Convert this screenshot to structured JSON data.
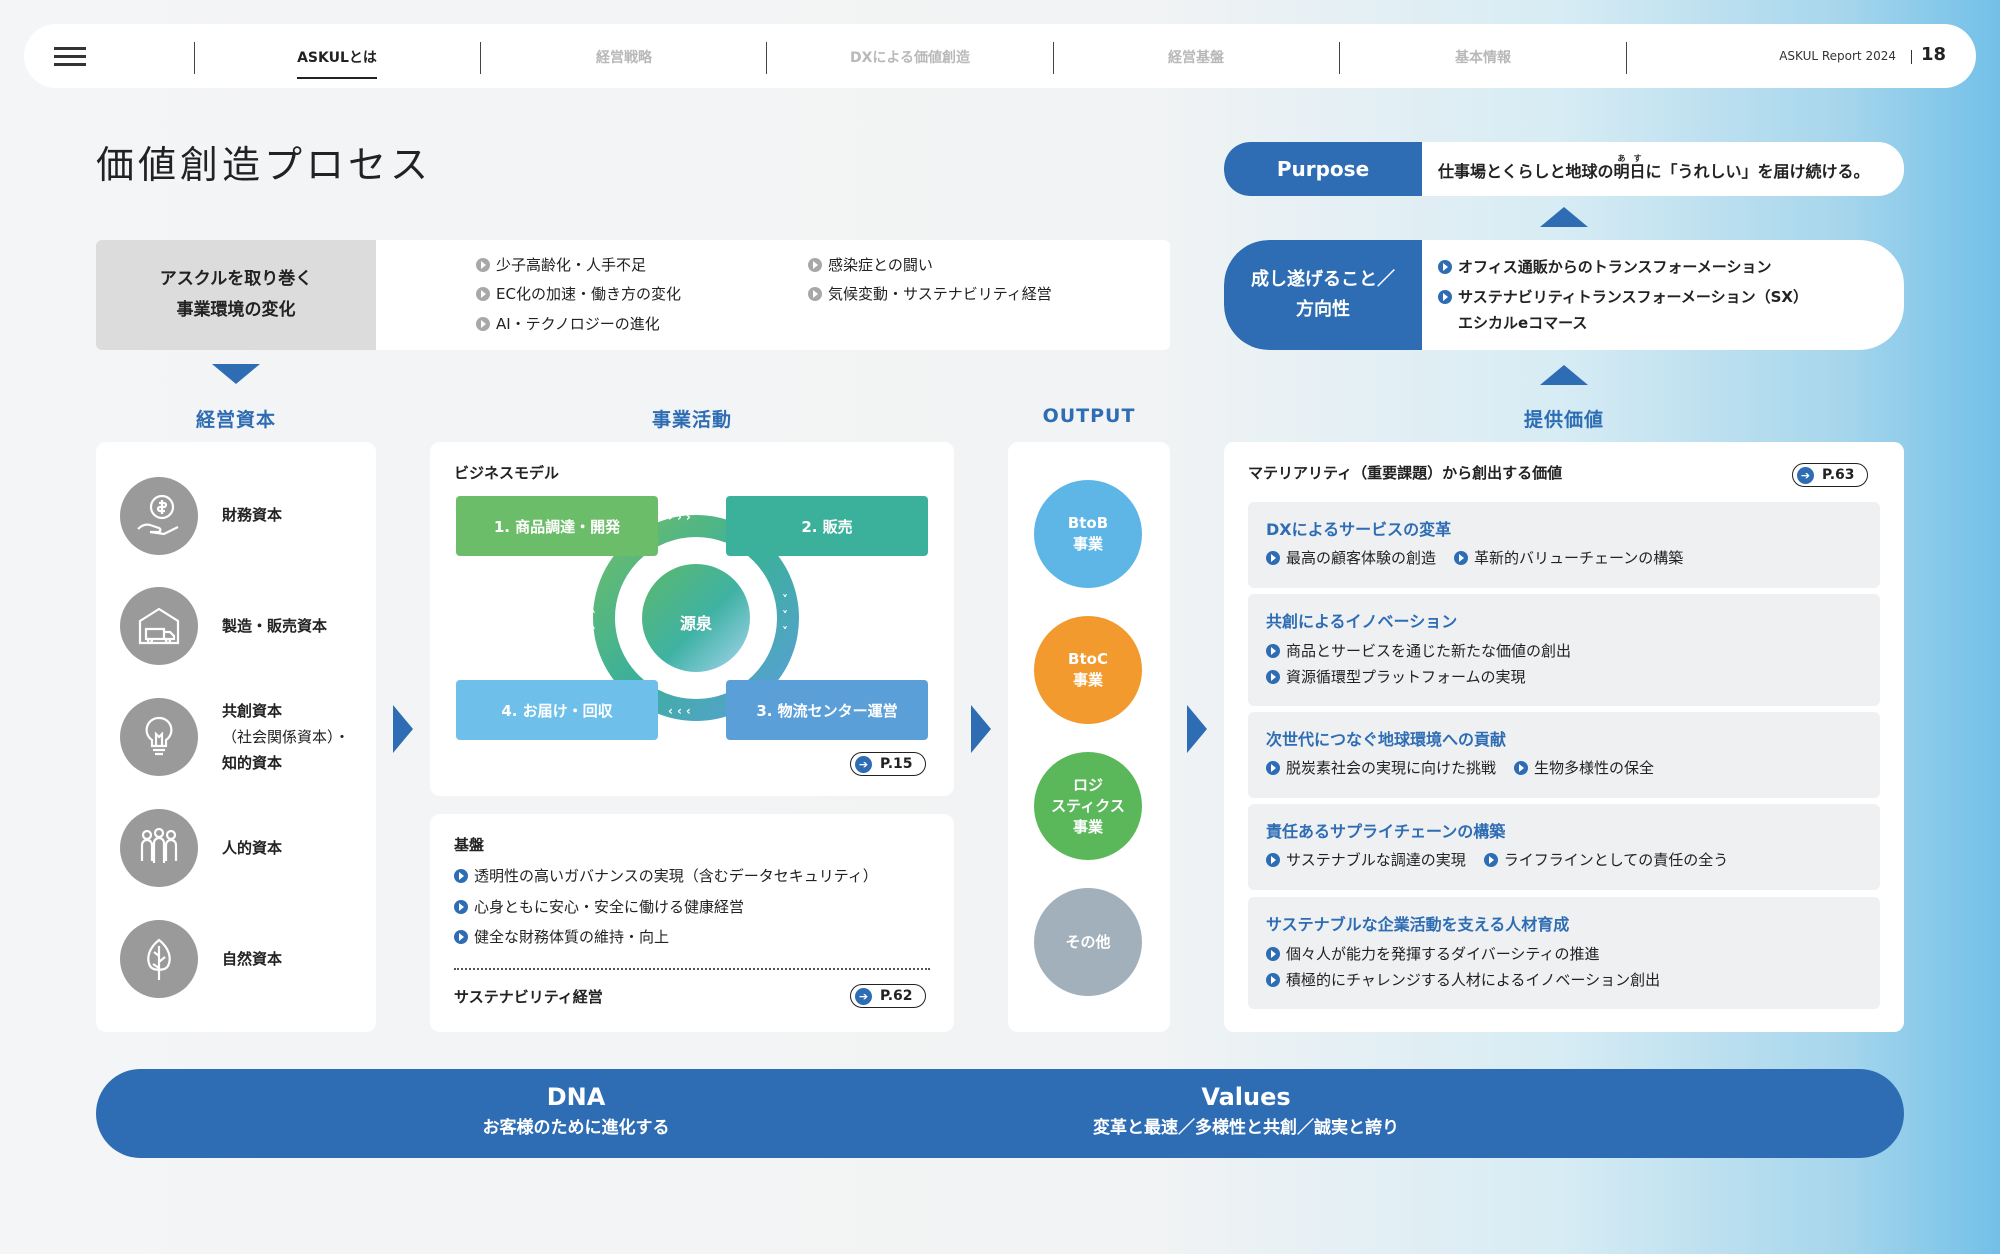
{
  "header": {
    "nav": [
      {
        "label": "ASKULとは",
        "active": true
      },
      {
        "label": "経営戦略",
        "active": false
      },
      {
        "label": "DXによる価値創造",
        "active": false
      },
      {
        "label": "経営基盤",
        "active": false
      },
      {
        "label": "基本情報",
        "active": false
      }
    ],
    "report": "ASKUL Report 2024",
    "page_number": "18"
  },
  "page_title": "価値創造プロセス",
  "purpose": {
    "label": "Purpose",
    "ruby": "あす",
    "text_before": "仕事場とくらしと地球の",
    "text_ruby_base": "明日",
    "text_after": "に「うれしい」を届け続ける。"
  },
  "direction": {
    "label_line1": "成し遂げること／",
    "label_line2": "方向性",
    "items": [
      "オフィス通販からのトランスフォーメーション",
      "サステナビリティトランスフォーメーション（SX）",
      "エシカルeコマース"
    ]
  },
  "environment": {
    "label_line1": "アスクルを取り巻く",
    "label_line2": "事業環境の変化",
    "col1": [
      "少子高齢化・人手不足",
      "EC化の加速・働き方の変化",
      "AI・テクノロジーの進化"
    ],
    "col2": [
      "感染症との闘い",
      "気候変動・サステナビリティ経営"
    ]
  },
  "sections": {
    "capital": "経営資本",
    "activity": "事業活動",
    "output": "OUTPUT",
    "value": "提供価値"
  },
  "capitals": [
    {
      "icon": "money-hand-icon",
      "lines": [
        "財務資本"
      ]
    },
    {
      "icon": "warehouse-truck-icon",
      "lines": [
        "製造・販売資本"
      ]
    },
    {
      "icon": "lightbulb-icon",
      "lines": [
        "共創資本",
        "（社会関係資本）・",
        "知的資本"
      ]
    },
    {
      "icon": "people-icon",
      "lines": [
        "人的資本"
      ]
    },
    {
      "icon": "leaf-icon",
      "lines": [
        "自然資本"
      ]
    }
  ],
  "business_model": {
    "title": "ビジネスモデル",
    "center": "源泉",
    "steps": [
      "1. 商品調達・開発",
      "2. 販売",
      "3. 物流センター運営",
      "4. お届け・回収"
    ],
    "ref": "P.15"
  },
  "foundation": {
    "title": "基盤",
    "items": [
      "透明性の高いガバナンスの実現（含むデータセキュリティ）",
      "心身ともに安心・安全に働ける健康経営",
      "健全な財務体質の維持・向上"
    ],
    "footer": "サステナビリティ経営",
    "ref": "P.62"
  },
  "outputs": [
    {
      "lines": [
        "BtoB",
        "事業"
      ],
      "color": "#5db6e6"
    },
    {
      "lines": [
        "BtoC",
        "事業"
      ],
      "color": "#f29a2e"
    },
    {
      "lines": [
        "ロジ",
        "スティクス",
        "事業"
      ],
      "color": "#5bb85a"
    },
    {
      "lines": [
        "その他"
      ],
      "color": "#a2b0bb"
    }
  ],
  "values": {
    "title": "マテリアリティ（重要課題）から創出する価値",
    "ref": "P.63",
    "items": [
      {
        "title": "DXによるサービスの変革",
        "lines": [
          [
            "最高の顧客体験の創造",
            "革新的バリューチェーンの構築"
          ]
        ]
      },
      {
        "title": "共創によるイノベーション",
        "lines": [
          [
            "商品とサービスを通じた新たな価値の創出"
          ],
          [
            "資源循環型プラットフォームの実現"
          ]
        ]
      },
      {
        "title": "次世代につなぐ地球環境への貢献",
        "lines": [
          [
            "脱炭素社会の実現に向けた挑戦",
            "生物多様性の保全"
          ]
        ]
      },
      {
        "title": "責任あるサプライチェーンの構築",
        "lines": [
          [
            "サステナブルな調達の実現",
            "ライフラインとしての責任の全う"
          ]
        ]
      },
      {
        "title": "サステナブルな企業活動を支える人材育成",
        "lines": [
          [
            "個々人が能力を発揮するダイバーシティの推進"
          ],
          [
            "積極的にチャレンジする人材によるイノベーション創出"
          ]
        ]
      }
    ]
  },
  "dna": {
    "title": "DNA",
    "text": "お客様のために進化する"
  },
  "company_values": {
    "title": "Values",
    "text": "変革と最速／多様性と共創／誠実と誇り"
  },
  "colors": {
    "accent": "#2e6db4",
    "bm_green": "#6cbd6a",
    "bm_teal": "#3bb09b",
    "bm_blue": "#5a9fd8",
    "bm_lightblue": "#6ec0ea"
  }
}
